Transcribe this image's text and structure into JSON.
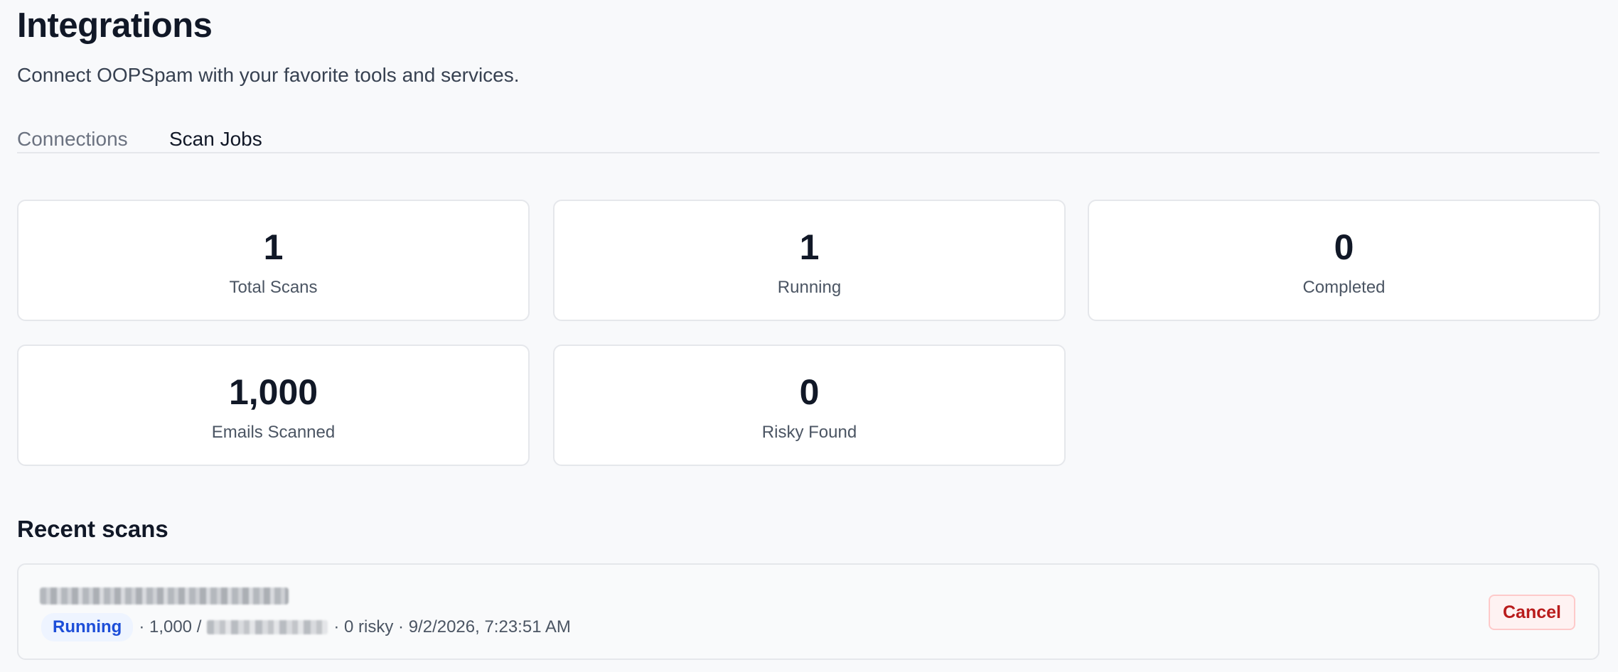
{
  "header": {
    "title": "Integrations",
    "subtitle": "Connect OOPSpam with your favorite tools and services."
  },
  "tabs": [
    {
      "label": "Connections",
      "active": false
    },
    {
      "label": "Scan Jobs",
      "active": true
    }
  ],
  "stats": [
    {
      "value": "1",
      "label": "Total Scans"
    },
    {
      "value": "1",
      "label": "Running"
    },
    {
      "value": "0",
      "label": "Completed"
    },
    {
      "value": "1,000",
      "label": "Emails Scanned"
    },
    {
      "value": "0",
      "label": "Risky Found"
    }
  ],
  "recent": {
    "title": "Recent scans",
    "scans": [
      {
        "status": "Running",
        "prefix": "· 1,000 /",
        "suffix": "· 0 risky · 9/2/2026, 7:23:51 AM",
        "cancel_label": "Cancel"
      }
    ]
  },
  "colors": {
    "accent": "#1d4ed8",
    "danger": "#b91c1c",
    "background": "#f8f9fb"
  }
}
